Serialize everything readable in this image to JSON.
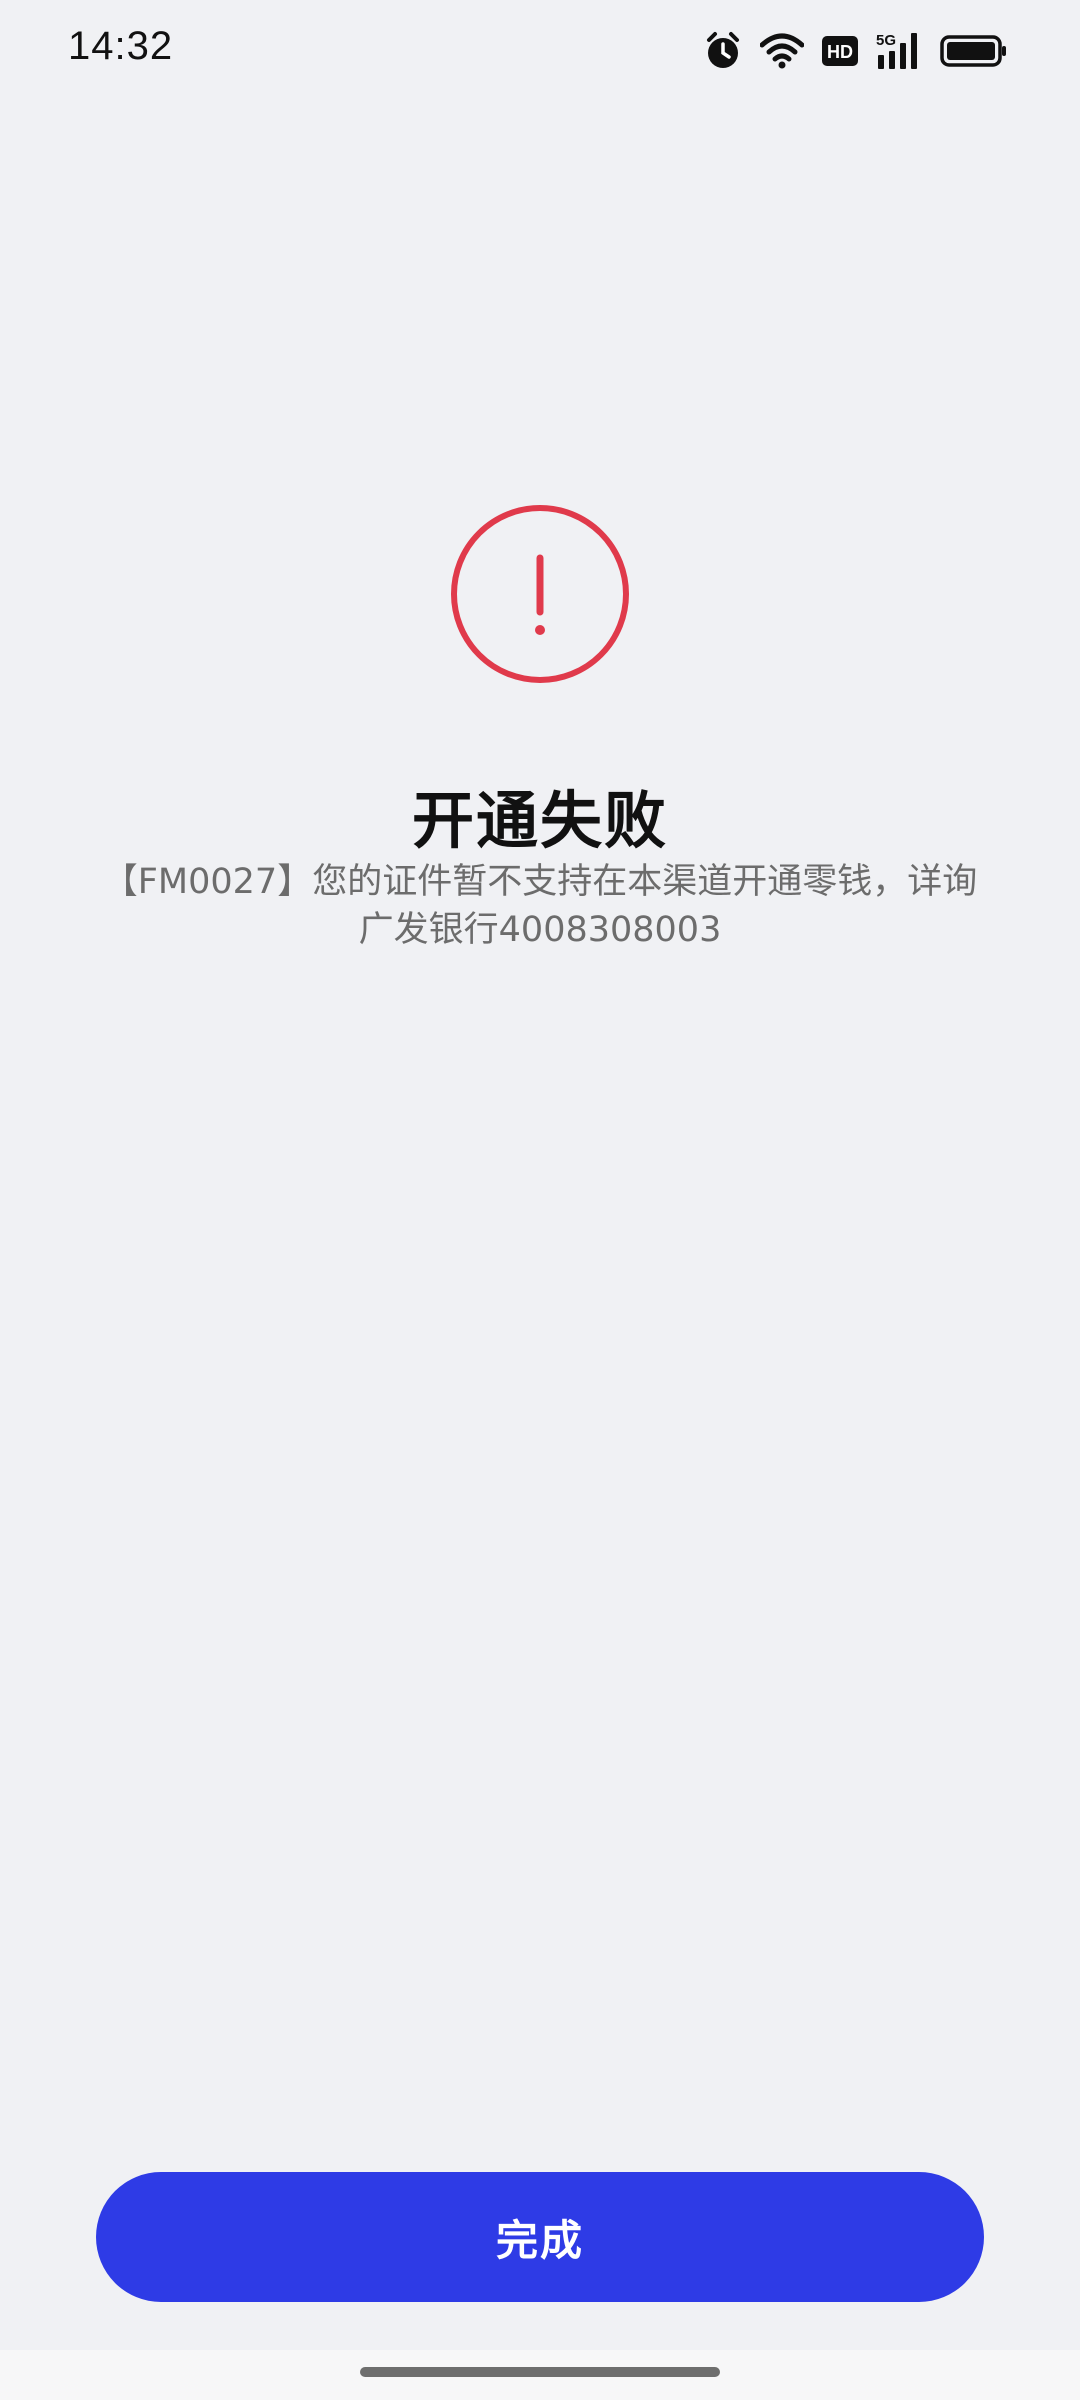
{
  "status_bar": {
    "time": "14:32",
    "icons": [
      "alarm-icon",
      "wifi-icon",
      "hd-icon",
      "signal-5g-icon",
      "battery-icon"
    ],
    "hd_label": "HD",
    "network_label": "5G"
  },
  "result": {
    "icon": "exclamation-circle-icon",
    "icon_color": "#e03a4b",
    "title": "开通失败",
    "message": "【FM0027】您的证件暂不支持在本渠道开通零钱，详询广发银行4008308003"
  },
  "footer": {
    "done_label": "完成",
    "button_color": "#2e3be6"
  }
}
